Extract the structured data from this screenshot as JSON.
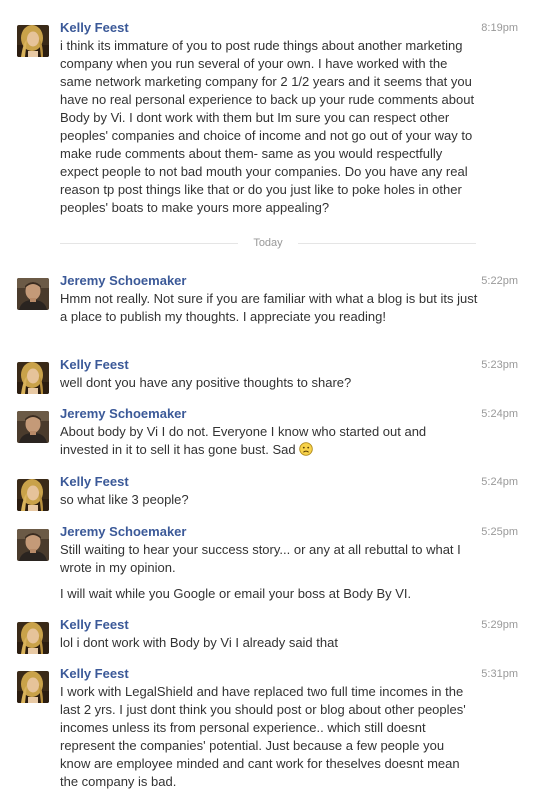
{
  "day_divider": "Today",
  "messages": [
    {
      "sender": "Kelly Feest",
      "time": "8:19pm",
      "paragraphs": [
        "i think its immature of you to post rude things about another marketing company when you run several of your own. I have worked with the same network marketing company for 2 1/2 years and it seems that you have no real personal experience to back up your rude comments about Body by Vi. I dont work with them but Im sure you can respect other peoples' companies and choice of income and not go out of your way to make rude comments about them- same as you would respectfully expect people to not bad mouth your companies. Do you have any real reason tp post things like that or do you just like to poke holes in other peoples' boats to make yours more appealing?"
      ]
    },
    {
      "sender": "Jeremy Schoemaker",
      "time": "5:22pm",
      "paragraphs": [
        "Hmm not really. Not sure if you are familiar with what a blog is but its just a place to publish my thoughts. I appreciate you reading!"
      ]
    },
    {
      "sender": "Kelly Feest",
      "time": "5:23pm",
      "paragraphs": [
        "well dont you have any positive thoughts to share?"
      ]
    },
    {
      "sender": "Jeremy Schoemaker",
      "time": "5:24pm",
      "paragraphs": [
        "About body by Vi I do not. Everyone I know who started out and invested in it to sell it has gone bust. Sad"
      ],
      "emoji": "frown-emoticon"
    },
    {
      "sender": "Kelly Feest",
      "time": "5:24pm",
      "paragraphs": [
        "so what like 3 people?"
      ]
    },
    {
      "sender": "Jeremy Schoemaker",
      "time": "5:25pm",
      "paragraphs": [
        "Still waiting to hear your success story... or any at all rebuttal to what I wrote in my opinion.",
        "I will wait while you Google or email your boss at Body By VI."
      ]
    },
    {
      "sender": "Kelly Feest",
      "time": "5:29pm",
      "paragraphs": [
        "lol i dont work with Body by Vi I already said that"
      ]
    },
    {
      "sender": "Kelly Feest",
      "time": "5:31pm",
      "paragraphs": [
        "I work with LegalShield and have replaced two full time incomes in the last 2 yrs. I just dont think you should post or blog about other peoples' incomes unless its from personal experience.. which still doesnt represent the companies' potential. Just because a few people you know are employee minded and cant work for theselves doesnt mean the company is bad."
      ]
    }
  ]
}
